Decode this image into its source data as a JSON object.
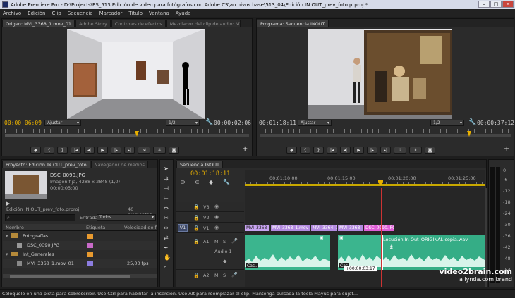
{
  "window": {
    "title": "Adobe Premiere Pro - D:\\Projects\\ES_513 Edición de video para fotógrafos con Adobe CS\\archivos base\\513_04\\Edición IN OUT_prev_foto.prproj *"
  },
  "menu": [
    "Archivo",
    "Edición",
    "Clip",
    "Secuencia",
    "Marcador",
    "Título",
    "Ventana",
    "Ayuda"
  ],
  "source": {
    "tabs": [
      "Origen: MVI_3368_1.mov_01",
      "Adobe Story",
      "Controles de efectos",
      "Mezclador del clip de audio: MVI_3368_1.mov_0"
    ],
    "timecode": "00:00:06:09",
    "fit": "Ajustar",
    "scale": "1/2",
    "duration": "00:00:02:06"
  },
  "program": {
    "tabs": [
      "Programa: Secuencia INOUT"
    ],
    "timecode": "00:01:18:11",
    "fit": "Ajustar",
    "scale": "1/2",
    "duration": "00:00:37:12"
  },
  "project": {
    "tabs": [
      "Proyecto: Edición IN OUT_prev_foto",
      "Navegador de medios"
    ],
    "item_name": "DSC_0090.JPG",
    "item_info1": "Imagen fija, 4288 x 2848 (1,0)",
    "item_info2": "00:00:05:00",
    "project_file": "Edición IN OUT_prev_foto.prproj",
    "count": "40 elementos",
    "in_label": "Entrada:",
    "in_value": "Todos",
    "columns": [
      "Nombre",
      "Etiqueta",
      "Velocidad de f"
    ],
    "rows": [
      {
        "name": "Fotografías",
        "type": "folder",
        "color": "#e89a2f",
        "fps": ""
      },
      {
        "name": "DSC_0090.JPG",
        "type": "image",
        "color": "#c86ac8",
        "fps": ""
      },
      {
        "name": "Int_Generales",
        "type": "folder",
        "color": "#e89a2f",
        "fps": ""
      },
      {
        "name": "MVI_3368_1.mov_01",
        "type": "clip",
        "color": "#8c7de0",
        "fps": "25,00 fps"
      }
    ]
  },
  "timeline": {
    "tabs": [
      "Secuencia INOUT"
    ],
    "timecode": "00:01:18:11",
    "ruler_labels": [
      "00:01:10:00",
      "00:01:15:00",
      "00:01:20:00",
      "00:01:25:00"
    ],
    "tracks": [
      {
        "name": "V3",
        "kind": "video"
      },
      {
        "name": "V2",
        "kind": "video"
      },
      {
        "name": "V1",
        "src": "V1",
        "kind": "video"
      },
      {
        "name": "A1",
        "label": "Audio 1",
        "kind": "audio"
      },
      {
        "name": "A2",
        "kind": "audio"
      }
    ],
    "video_clips": [
      {
        "label": "MVI_3368_1.mov_01",
        "color": "#c7a3f0"
      },
      {
        "label": "MVI_3368_1.mov",
        "color": "#b38ae0"
      },
      {
        "label": "MVI_3364_1.",
        "color": "#b38ae0"
      },
      {
        "label": "MVI_3368_1.",
        "color": "#b38ae0"
      },
      {
        "label": "DSC_0090.JPG",
        "color": "#e05ed8"
      }
    ],
    "audio_clip_label": "Locución In Out_ORIGINAL copia.wav",
    "audio_left_label": "Cas..",
    "audio_mid_label": "Cas",
    "tooltip": "+00:00:03:17",
    "vu_labels": [
      "0",
      "-6",
      "-12",
      "-18",
      "-24",
      "-30",
      "-36",
      "-42",
      "-48",
      "-54"
    ]
  },
  "watermark": {
    "line1": "video2brain.com",
    "line2": "a lynda.com brand"
  },
  "status": "Colóquelo en una pista para sobrescribir. Use Ctrl para habilitar la inserción. Use Alt para reemplazar el clip. Mantenga pulsada la tecla Mayús para sujet..."
}
